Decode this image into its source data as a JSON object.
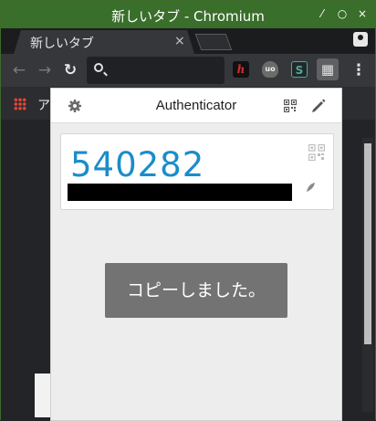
{
  "window": {
    "title": "新しいタブ - Chromium",
    "controls": {
      "minimize": "⁄",
      "maximize": "○",
      "close": "×"
    }
  },
  "tabs": [
    {
      "label": "新しいタブ",
      "close": "×"
    }
  ],
  "toolbar": {
    "back": "←",
    "forward": "→",
    "reload": "↻",
    "menu": "⋮",
    "extensions": [
      {
        "name": "h-extension",
        "glyph": "h",
        "color": "#d32f2f"
      },
      {
        "name": "ublock-extension",
        "glyph": "uo",
        "color": "#9e9e9e"
      },
      {
        "name": "s-extension",
        "glyph": "S",
        "color": "#5aa39a"
      },
      {
        "name": "authenticator-extension",
        "glyph": "▦",
        "color": "#e0e0e0"
      }
    ]
  },
  "bookmarks": {
    "apps_label": "ア"
  },
  "popup": {
    "title": "Authenticator",
    "entries": [
      {
        "code": "540282"
      }
    ],
    "toast": "コピーしました。"
  },
  "colors": {
    "titlebar": "#3a6e2b",
    "code": "#1b8dc9",
    "toast": "#737373"
  }
}
